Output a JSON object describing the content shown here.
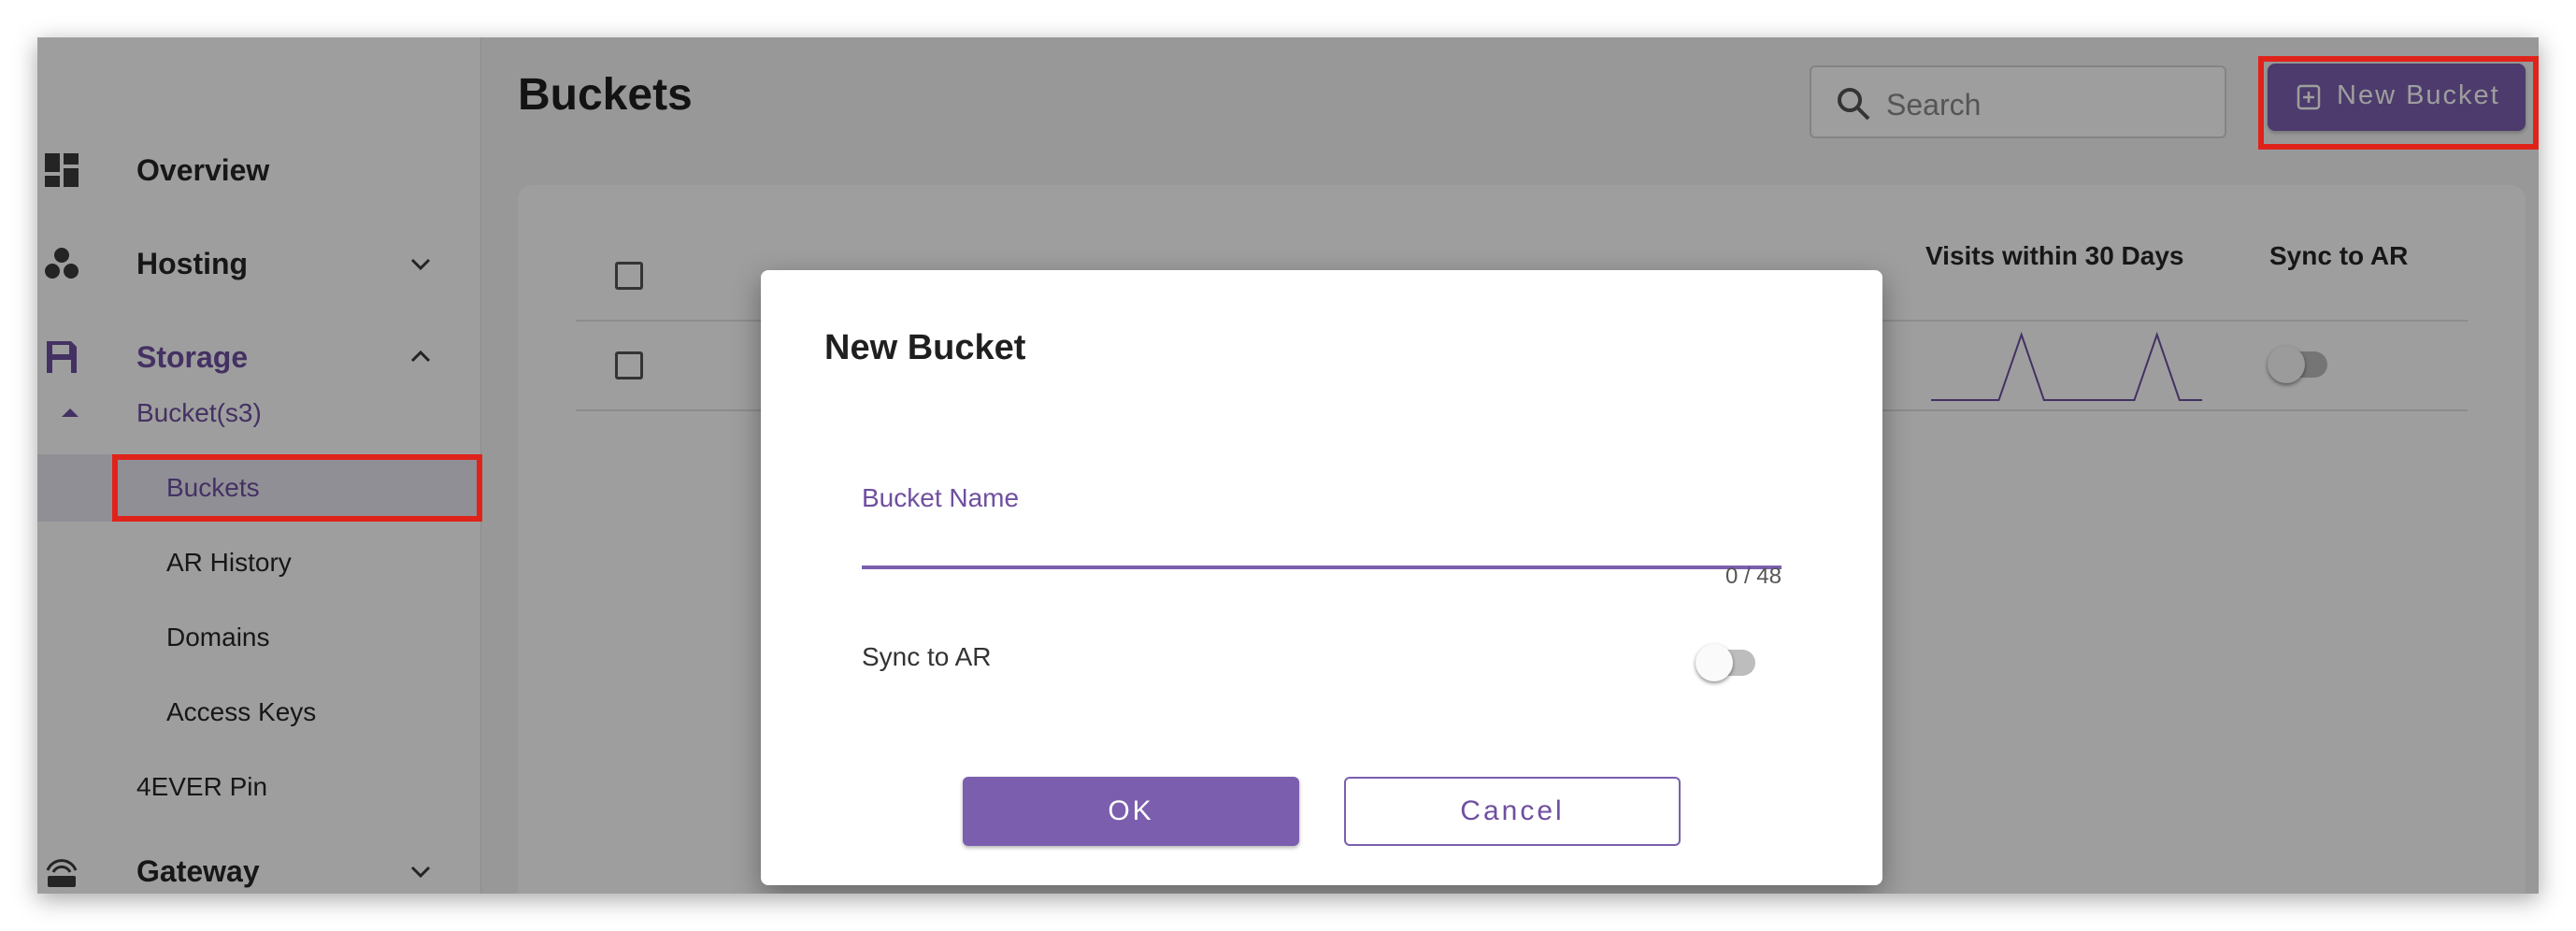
{
  "sidebar": {
    "overview": "Overview",
    "hosting": "Hosting",
    "storage": "Storage",
    "bucket_group": "Bucket(s3)",
    "buckets": "Buckets",
    "ar_history": "AR History",
    "domains": "Domains",
    "access_keys": "Access Keys",
    "pin": "4EVER Pin",
    "gateway": "Gateway"
  },
  "header": {
    "title": "Buckets",
    "search_placeholder": "Search",
    "new_bucket_label": "New Bucket"
  },
  "table": {
    "columns": [
      "Visits within 30 Days",
      "Sync to AR"
    ],
    "rows": [
      {
        "visits_sparkline": [
          0,
          0,
          0,
          0,
          1,
          0,
          0,
          0,
          0,
          0,
          1,
          0,
          0
        ],
        "sync_to_ar": false
      }
    ]
  },
  "dialog": {
    "title": "New Bucket",
    "bucket_name_label": "Bucket Name",
    "bucket_name_value": "",
    "counter": "0 / 48",
    "sync_label": "Sync to AR",
    "sync_value": false,
    "ok_label": "OK",
    "cancel_label": "Cancel"
  },
  "colors": {
    "accent": "#7b5fae",
    "highlight": "#e0231a"
  }
}
